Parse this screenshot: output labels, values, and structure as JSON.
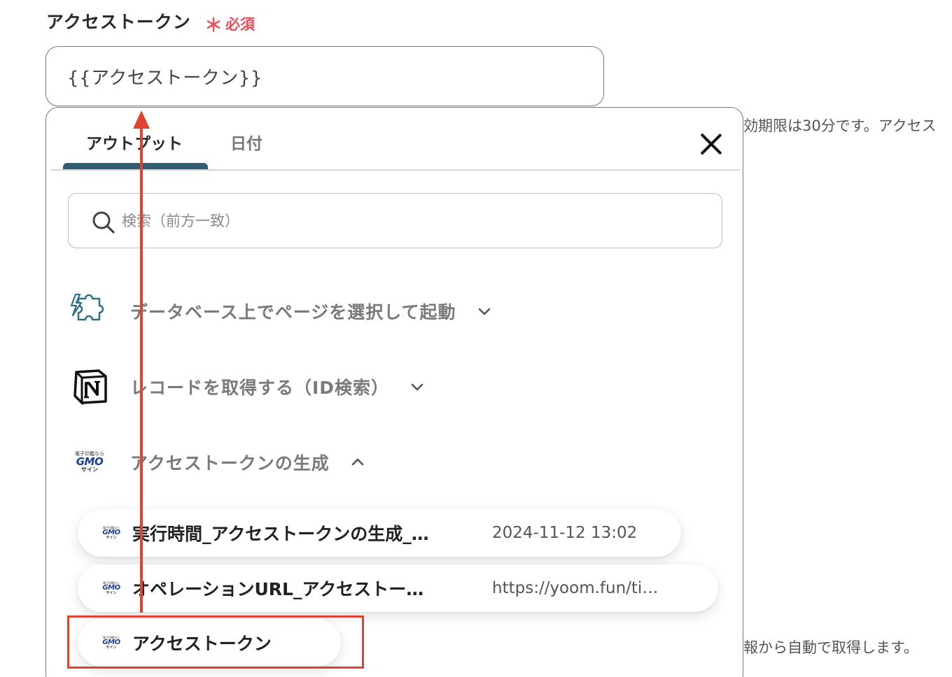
{
  "field": {
    "label": "アクセストークン",
    "required_mark": "＊",
    "required_text": "必須",
    "value": "{{アクセストークン}}"
  },
  "background_help": {
    "line1": "効期限は30分です。アクセス",
    "line2": "報から自動で取得します。"
  },
  "popover": {
    "tabs": [
      {
        "label": "アウトプット",
        "active": true
      },
      {
        "label": "日付",
        "active": false
      }
    ],
    "search_placeholder": "検索（前方一致）",
    "groups": [
      {
        "title": "データベース上でページを選択して起動",
        "icon": "puzzle-bolt-icon",
        "expanded": false
      },
      {
        "title": "レコードを取得する（ID検索）",
        "icon": "notion-logo",
        "expanded": false
      },
      {
        "title": "アクセストークンの生成",
        "icon": "gmo-sign-logo",
        "expanded": true
      }
    ],
    "items": [
      {
        "name": "実行時間_アクセストークンの生成_…",
        "value": "2024-11-12 13:02"
      },
      {
        "name": "オペレーションURL_アクセストー…",
        "value": "https://yoom.fun/ti…"
      },
      {
        "name": "アクセストークン",
        "value": ""
      }
    ],
    "gmo_logo": {
      "top": "電子印鑑なら",
      "mid": "GMO",
      "bot": "サイン"
    }
  },
  "colors": {
    "required": "#e84d5b",
    "tab_underline": "#2f5d72",
    "annotation": "#e0432f",
    "gmo_blue": "#1d3f8f"
  }
}
